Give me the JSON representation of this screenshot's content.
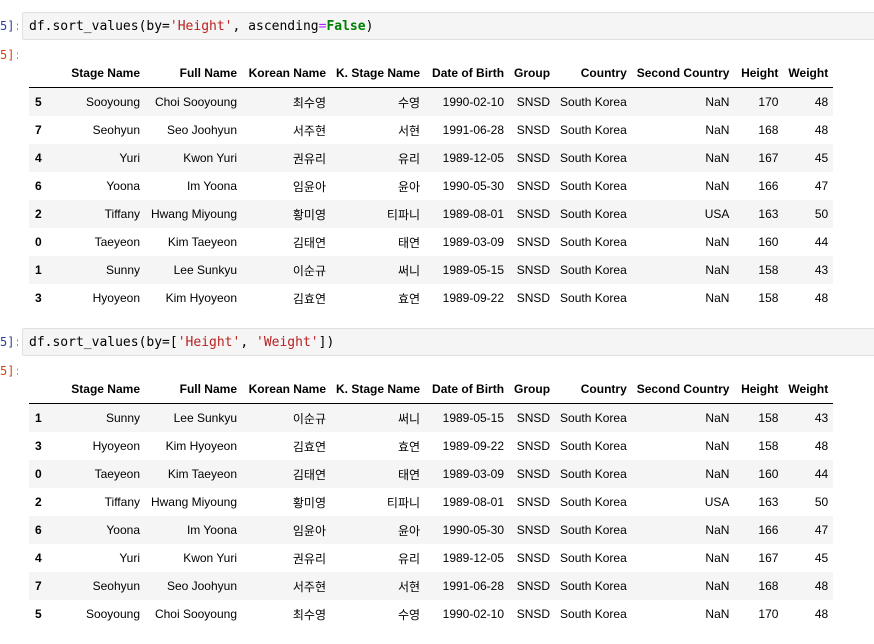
{
  "cell1": {
    "in_prompt": "5]:",
    "out_prompt": "5]:",
    "code": {
      "a": "df.sort_values(by=",
      "b": "'Height'",
      "c": ", ascending",
      "d": "=",
      "e": "False",
      "f": ")"
    }
  },
  "cell2": {
    "in_prompt": "5]:",
    "out_prompt": "5]:",
    "code": {
      "a": "df.sort_values(by=[",
      "b": "'Height'",
      "c": ", ",
      "d": "'Weight'",
      "e": "])"
    }
  },
  "columns": [
    "Stage Name",
    "Full Name",
    "Korean Name",
    "K. Stage Name",
    "Date of Birth",
    "Group",
    "Country",
    "Second Country",
    "Height",
    "Weight"
  ],
  "table1": [
    [
      "5",
      "Sooyoung",
      "Choi Sooyoung",
      "최수영",
      "수영",
      "1990-02-10",
      "SNSD",
      "South Korea",
      "NaN",
      "170",
      "48"
    ],
    [
      "7",
      "Seohyun",
      "Seo Joohyun",
      "서주현",
      "서현",
      "1991-06-28",
      "SNSD",
      "South Korea",
      "NaN",
      "168",
      "48"
    ],
    [
      "4",
      "Yuri",
      "Kwon Yuri",
      "권유리",
      "유리",
      "1989-12-05",
      "SNSD",
      "South Korea",
      "NaN",
      "167",
      "45"
    ],
    [
      "6",
      "Yoona",
      "Im Yoona",
      "임윤아",
      "윤아",
      "1990-05-30",
      "SNSD",
      "South Korea",
      "NaN",
      "166",
      "47"
    ],
    [
      "2",
      "Tiffany",
      "Hwang Miyoung",
      "황미영",
      "티파니",
      "1989-08-01",
      "SNSD",
      "South Korea",
      "USA",
      "163",
      "50"
    ],
    [
      "0",
      "Taeyeon",
      "Kim Taeyeon",
      "김태연",
      "태연",
      "1989-03-09",
      "SNSD",
      "South Korea",
      "NaN",
      "160",
      "44"
    ],
    [
      "1",
      "Sunny",
      "Lee Sunkyu",
      "이순규",
      "써니",
      "1989-05-15",
      "SNSD",
      "South Korea",
      "NaN",
      "158",
      "43"
    ],
    [
      "3",
      "Hyoyeon",
      "Kim Hyoyeon",
      "김효연",
      "효연",
      "1989-09-22",
      "SNSD",
      "South Korea",
      "NaN",
      "158",
      "48"
    ]
  ],
  "table2": [
    [
      "1",
      "Sunny",
      "Lee Sunkyu",
      "이순규",
      "써니",
      "1989-05-15",
      "SNSD",
      "South Korea",
      "NaN",
      "158",
      "43"
    ],
    [
      "3",
      "Hyoyeon",
      "Kim Hyoyeon",
      "김효연",
      "효연",
      "1989-09-22",
      "SNSD",
      "South Korea",
      "NaN",
      "158",
      "48"
    ],
    [
      "0",
      "Taeyeon",
      "Kim Taeyeon",
      "김태연",
      "태연",
      "1989-03-09",
      "SNSD",
      "South Korea",
      "NaN",
      "160",
      "44"
    ],
    [
      "2",
      "Tiffany",
      "Hwang Miyoung",
      "황미영",
      "티파니",
      "1989-08-01",
      "SNSD",
      "South Korea",
      "USA",
      "163",
      "50"
    ],
    [
      "6",
      "Yoona",
      "Im Yoona",
      "임윤아",
      "윤아",
      "1990-05-30",
      "SNSD",
      "South Korea",
      "NaN",
      "166",
      "47"
    ],
    [
      "4",
      "Yuri",
      "Kwon Yuri",
      "권유리",
      "유리",
      "1989-12-05",
      "SNSD",
      "South Korea",
      "NaN",
      "167",
      "45"
    ],
    [
      "7",
      "Seohyun",
      "Seo Joohyun",
      "서주현",
      "서현",
      "1991-06-28",
      "SNSD",
      "South Korea",
      "NaN",
      "168",
      "48"
    ],
    [
      "5",
      "Sooyoung",
      "Choi Sooyoung",
      "최수영",
      "수영",
      "1990-02-10",
      "SNSD",
      "South Korea",
      "NaN",
      "170",
      "48"
    ]
  ]
}
